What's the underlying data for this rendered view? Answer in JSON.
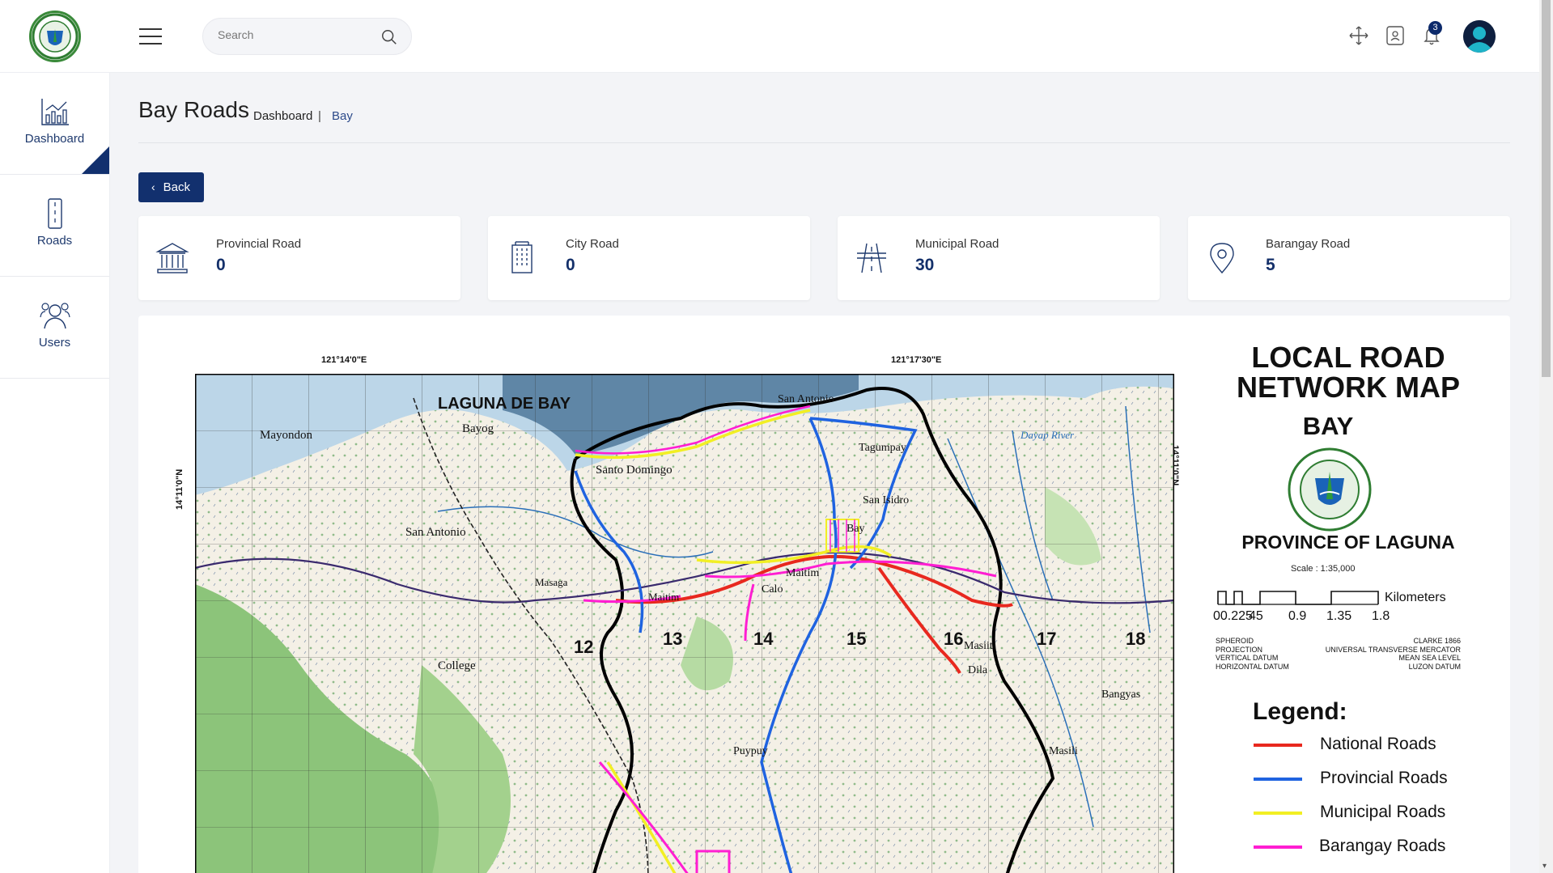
{
  "header": {
    "search_placeholder": "Search",
    "notification_count": "3",
    "icons": [
      "logo-seal",
      "menu-icon",
      "search-icon",
      "fullscreen-icon",
      "id-card-icon",
      "bell-icon",
      "user-avatar"
    ]
  },
  "sidebar": {
    "items": [
      {
        "label": "Dashboard",
        "icon": "bar-chart-icon",
        "active": true
      },
      {
        "label": "Roads",
        "icon": "road-icon",
        "active": false
      },
      {
        "label": "Users",
        "icon": "users-icon",
        "active": false
      }
    ]
  },
  "page": {
    "title": "Bay Roads",
    "breadcrumb": [
      "Dashboard",
      "Bay"
    ],
    "breadcrumb_sep": "|",
    "back_label": "Back"
  },
  "stats": [
    {
      "label": "Provincial Road",
      "value": "0",
      "icon": "building-columns-icon"
    },
    {
      "label": "City Road",
      "value": "0",
      "icon": "city-building-icon"
    },
    {
      "label": "Municipal Road",
      "value": "30",
      "icon": "highway-icon"
    },
    {
      "label": "Barangay Road",
      "value": "5",
      "icon": "map-pin-icon"
    }
  ],
  "map": {
    "title_line1": "LOCAL ROAD",
    "title_line2": "NETWORK MAP",
    "title_line3": "BAY",
    "province": "PROVINCE OF LAGUNA",
    "scale": "Scale : 1:35,000",
    "km_label": "Kilometers",
    "km_ticks": [
      "00.225",
      "45",
      "0.9",
      "1.35",
      "1.8"
    ],
    "coords": {
      "top_left": "121°14'0\"E",
      "top_right": "121°17'30\"E",
      "left": "14°11'0\"N",
      "right": "14°11'0\"N"
    },
    "datum": [
      {
        "k": "SPHEROID",
        "v": "CLARKE 1866"
      },
      {
        "k": "PROJECTION",
        "v": "UNIVERSAL TRANSVERSE MERCATOR"
      },
      {
        "k": "VERTICAL DATUM",
        "v": "MEAN SEA LEVEL"
      },
      {
        "k": "HORIZONTAL DATUM",
        "v": "LUZON DATUM"
      }
    ],
    "legend_title": "Legend:",
    "legend": [
      {
        "label": "National Roads",
        "color": "#e8281e"
      },
      {
        "label": "Provincial Roads",
        "color": "#1f63e0"
      },
      {
        "label": "Municipal Roads",
        "color": "#f2ef23"
      },
      {
        "label": "Barangay Roads",
        "color": "#ff1ed2"
      }
    ],
    "place_labels": [
      "LAGUNA DE BAY",
      "San Antonio",
      "Mayondon",
      "Bayog",
      "Santo Domingo",
      "Tagumpay",
      "San Isidro",
      "Bay",
      "San Antonio",
      "Maitim",
      "Calo",
      "Masiit",
      "Dila",
      "College",
      "Puypuy",
      "Masili",
      "Bangyas",
      "Dayap River",
      "Maitim",
      "Masaga"
    ],
    "grid_numbers": [
      "12",
      "13",
      "14",
      "15",
      "16",
      "17",
      "18"
    ]
  },
  "colors": {
    "primary": "#12306e",
    "text_blue": "#14306a"
  }
}
